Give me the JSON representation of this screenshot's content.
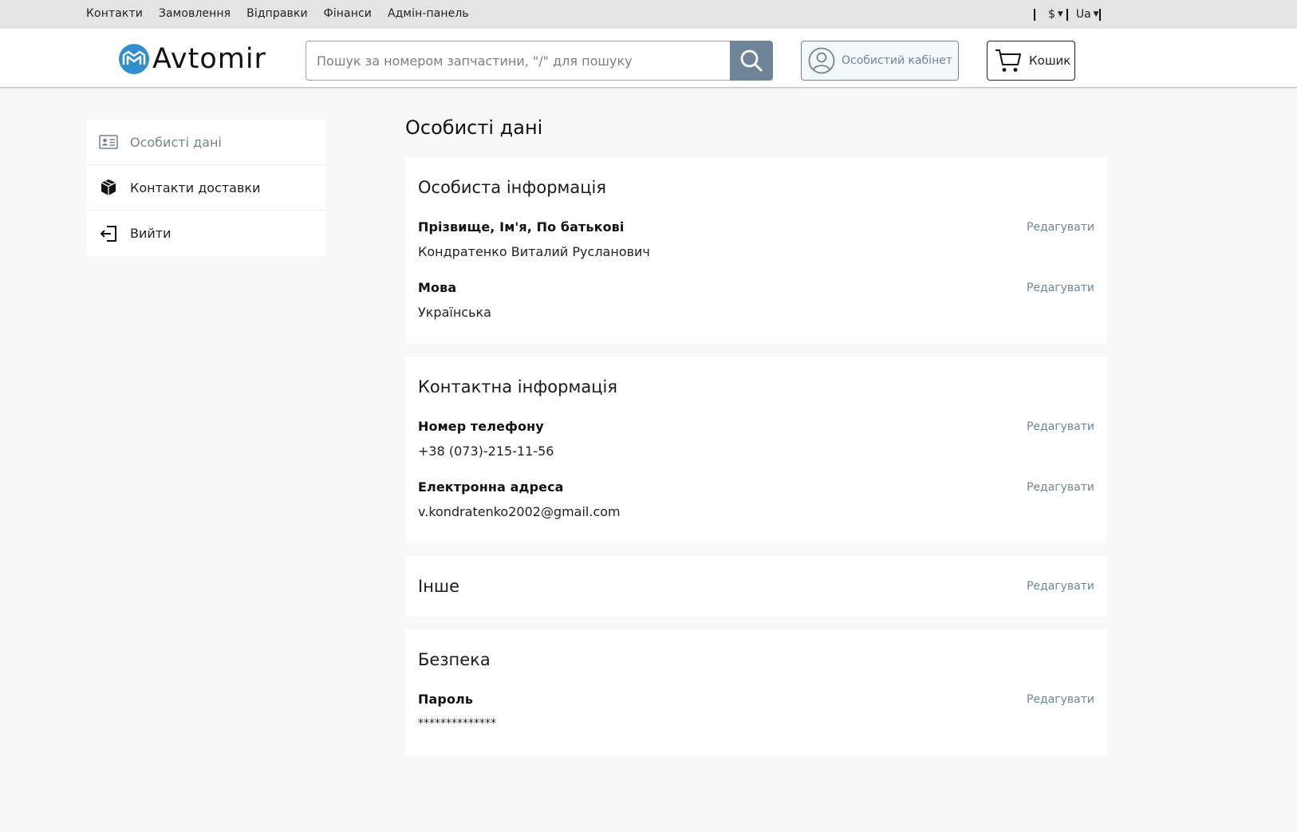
{
  "topnav": {
    "links": [
      "Контакти",
      "Замовлення",
      "Відправки",
      "Фінанси",
      "Адмін-панель"
    ],
    "currency": "$",
    "language": "Ua"
  },
  "header": {
    "logo_text": "Avtomir",
    "search_placeholder": "Пошук за номером запчастини, \"/\" для пошуку",
    "account_label": "Особистий кабінет",
    "cart_label": "Кошик"
  },
  "sidebar": {
    "items": [
      {
        "label": "Особисті дані",
        "icon": "id-card-icon",
        "active": true
      },
      {
        "label": "Контакти доставки",
        "icon": "boxes-icon",
        "active": false
      },
      {
        "label": "Вийти",
        "icon": "logout-icon",
        "active": false
      }
    ]
  },
  "main": {
    "title": "Особисті дані",
    "edit_label": "Редагувати",
    "personal": {
      "heading": "Особиста інформація",
      "name_label": "Прізвище, Ім'я, По батькові",
      "name_value": "Кондратенко Виталий Русланович",
      "lang_label": "Мова",
      "lang_value": "Українська"
    },
    "contact": {
      "heading": "Контактна інформація",
      "phone_label": "Номер телефону",
      "phone_value": "+38 (073)-215-11-56",
      "email_label": "Електронна адреса",
      "email_value": "v.kondratenko2002@gmail.com"
    },
    "other": {
      "heading": "Інше"
    },
    "security": {
      "heading": "Безпека",
      "password_label": "Пароль",
      "password_value": "**************"
    }
  },
  "colors": {
    "accent": "#6f8597",
    "logo_blue": "#2f8fcf",
    "topbar": "#e4e4e4",
    "page_bg": "#f8f8f8"
  }
}
